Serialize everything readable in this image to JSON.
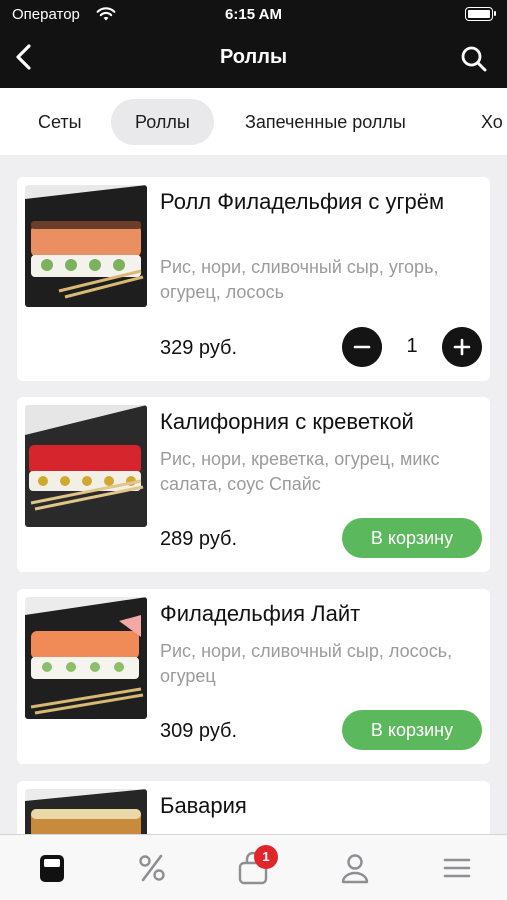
{
  "status_bar": {
    "carrier": "Оператор",
    "time": "6:15 AM"
  },
  "header": {
    "title": "Роллы",
    "back_icon": "chevron-left-icon",
    "search_icon": "search-icon"
  },
  "category_tabs": [
    {
      "label": "Сеты",
      "active": false
    },
    {
      "label": "Роллы",
      "active": true
    },
    {
      "label": "Запеченные роллы",
      "active": false
    },
    {
      "label": "Хо",
      "active": false
    }
  ],
  "products": [
    {
      "name": "Ролл Филадельфия с угрём",
      "description": "Рис, нори, сливочный сыр, угорь, огурец, лосось",
      "price": "329 руб.",
      "in_cart": true,
      "quantity": "1"
    },
    {
      "name": "Калифорния с креветкой",
      "description": "Рис, нори, креветка, огурец, микс салата, соус Спайс",
      "price": "289 руб.",
      "in_cart": false,
      "button": "В корзину"
    },
    {
      "name": "Филадельфия Лайт",
      "description": "Рис, нори, сливочный сыр, лосось, огурец",
      "price": "309 руб.",
      "in_cart": false,
      "button": "В корзину"
    },
    {
      "name": "Бавария"
    }
  ],
  "tab_bar": {
    "items": [
      "menu-icon",
      "discount-icon",
      "cart-icon",
      "profile-icon",
      "more-icon"
    ],
    "cart_badge": "1"
  },
  "colors": {
    "header_bg": "#121212",
    "accent_green": "#5cb85c",
    "badge_red": "#e0262b"
  }
}
